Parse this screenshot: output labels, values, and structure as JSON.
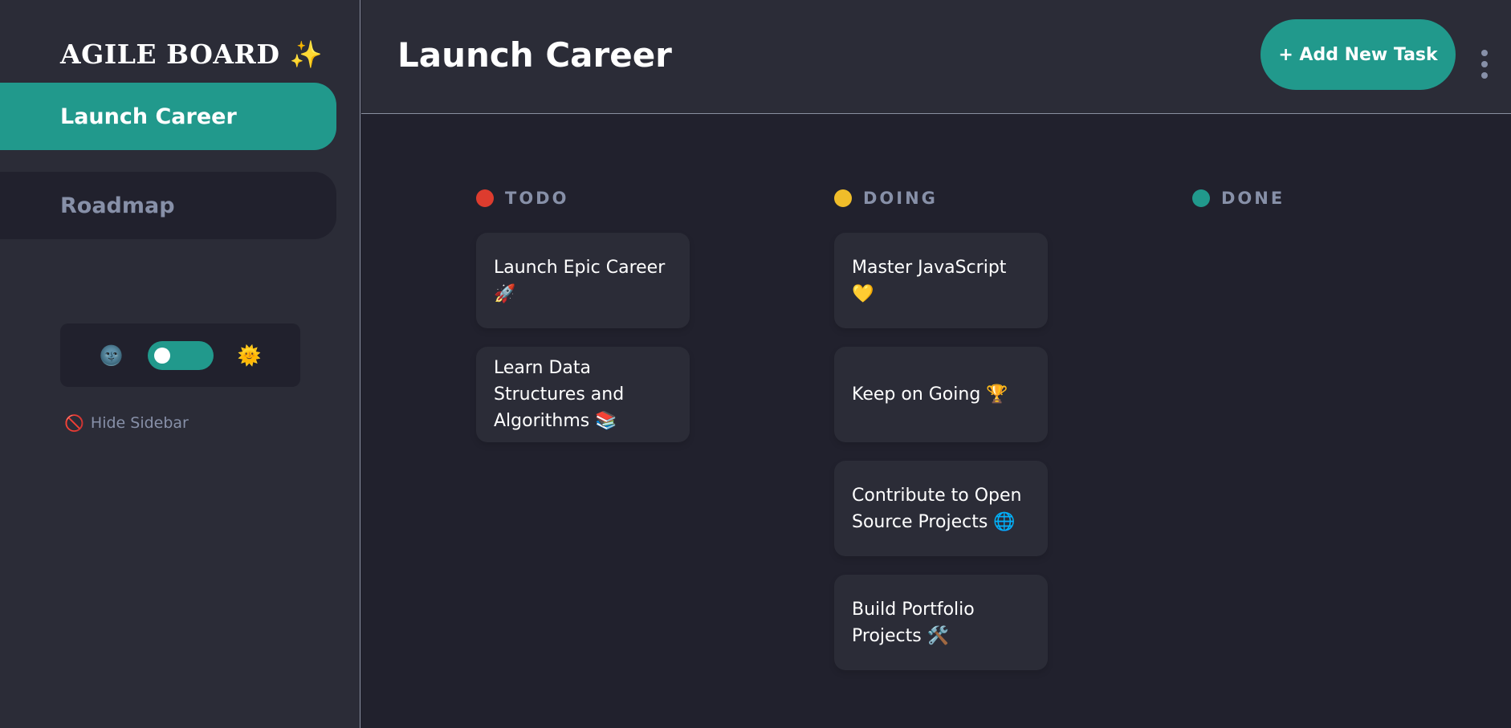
{
  "sidebar": {
    "brand": "AGILE BOARD ✨",
    "boards": [
      {
        "label": "Launch Career"
      },
      {
        "label": "Roadmap"
      }
    ],
    "theme": {
      "dark_icon": "🌚",
      "light_icon": "🌞"
    },
    "hide_sidebar": {
      "icon": "🚫",
      "label": "Hide Sidebar"
    }
  },
  "header": {
    "title": "Launch Career",
    "add_task_label": "+ Add New Task"
  },
  "columns": [
    {
      "name": "TODO",
      "color": "#dd3c2e",
      "cards": [
        {
          "title": "Launch Epic Career 🚀"
        },
        {
          "title": "Learn Data Structures and Algorithms 📚"
        }
      ]
    },
    {
      "name": "DOING",
      "color": "#f0bd2a",
      "cards": [
        {
          "title": "Master JavaScript 💛"
        },
        {
          "title": "Keep on Going 🏆"
        },
        {
          "title": "Contribute to Open Source Projects 🌐"
        },
        {
          "title": "Build Portfolio Projects 🛠️"
        }
      ]
    },
    {
      "name": "DONE",
      "color": "#21998c",
      "cards": []
    }
  ],
  "colors": {
    "accent": "#21998c",
    "background": "#21212d",
    "panel": "#2b2c37",
    "muted_text": "#8790a8"
  }
}
